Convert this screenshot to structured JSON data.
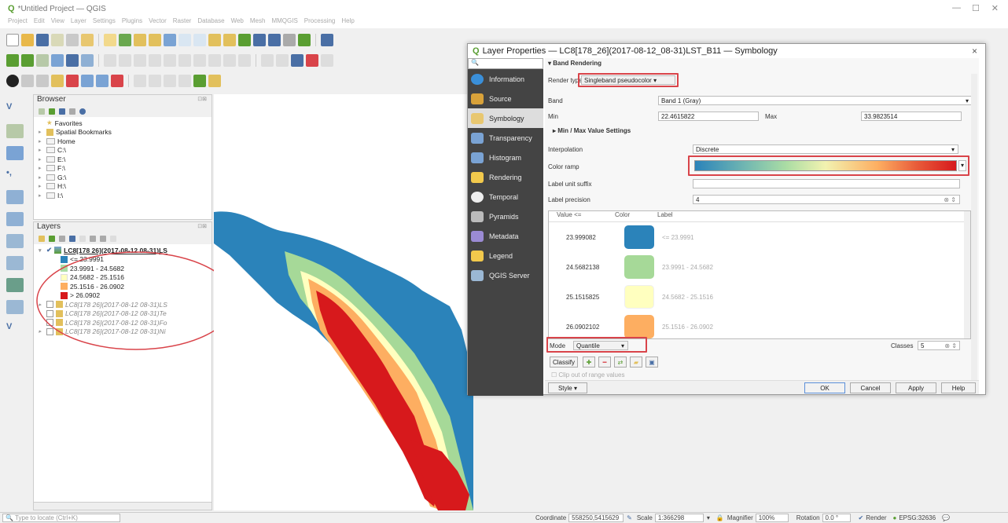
{
  "window": {
    "title": "*Untitled Project — QGIS"
  },
  "menu": [
    "Project",
    "Edit",
    "View",
    "Layer",
    "Settings",
    "Plugins",
    "Vector",
    "Raster",
    "Database",
    "Web",
    "Mesh",
    "MMQGIS",
    "Processing",
    "Help"
  ],
  "browser": {
    "title": "Browser",
    "items": [
      "Favorites",
      "Spatial Bookmarks",
      "Home",
      "C:\\",
      "E:\\",
      "F:\\",
      "G:\\",
      "H:\\",
      "I:\\"
    ]
  },
  "layers": {
    "title": "Layers",
    "active": "LC8[178 26](2017-08-12 08-31)LS",
    "legend": [
      {
        "label": "<= 23.9991",
        "color": "#2b83ba"
      },
      {
        "label": "23.9991 - 24.5682",
        "color": "#abdda4"
      },
      {
        "label": "24.5682 - 25.1516",
        "color": "#ffffbf"
      },
      {
        "label": "25.1516 - 26.0902",
        "color": "#fdae61"
      },
      {
        "label": "> 26.0902",
        "color": "#d7191c"
      }
    ],
    "others": [
      "LC8[178 26](2017-08-12 08-31)LS",
      "LC8[178 26](2017-08-12 08-31)Te",
      "LC8[178 26](2017-08-12 08-31)Fo",
      "LC8[178 26](2017-08-12 08-31)Ni"
    ]
  },
  "dialog": {
    "title": "Layer Properties — LC8[178_26](2017-08-12_08-31)LST_B11 — Symbology",
    "close": "×",
    "nav": [
      {
        "label": "Information",
        "color": "#3a8fd9"
      },
      {
        "label": "Source",
        "color": "#d9a23a"
      },
      {
        "label": "Symbology",
        "color": "#e8c770"
      },
      {
        "label": "Transparency",
        "color": "#7aa3d4"
      },
      {
        "label": "Histogram",
        "color": "#7aa3d4"
      },
      {
        "label": "Rendering",
        "color": "#f2c94c"
      },
      {
        "label": "Temporal",
        "color": "#eeeeee"
      },
      {
        "label": "Pyramids",
        "color": "#bbbbbb"
      },
      {
        "label": "Metadata",
        "color": "#9b8bd4"
      },
      {
        "label": "Legend",
        "color": "#f2c94c"
      },
      {
        "label": "QGIS Server",
        "color": "#9bb8d4"
      }
    ],
    "section": "Band Rendering",
    "render_type_label": "Render type",
    "render_type": "Singleband pseudocolor",
    "band_label": "Band",
    "band": "Band 1 (Gray)",
    "min_label": "Min",
    "min": "22.4615822",
    "max_label": "Max",
    "max": "33.9823514",
    "minmax_section": "Min / Max Value Settings",
    "interp_label": "Interpolation",
    "interp": "Discrete",
    "ramp_label": "Color ramp",
    "unit_label": "Label unit suffix",
    "precision_label": "Label precision",
    "precision": "4",
    "cols": [
      "Value <=",
      "Color",
      "Label"
    ],
    "rows": [
      {
        "value": "23.999082",
        "color": "#2b83ba",
        "label": "<= 23.9991"
      },
      {
        "value": "24.5682138",
        "color": "#a6d998",
        "label": "23.9991 - 24.5682"
      },
      {
        "value": "25.1515825",
        "color": "#ffffbf",
        "label": "24.5682 - 25.1516"
      },
      {
        "value": "26.0902102",
        "color": "#fdae61",
        "label": "25.1516 - 26.0902"
      }
    ],
    "mode_label": "Mode",
    "mode": "Quantile",
    "classes_label": "Classes",
    "classes": "5",
    "classify": "Classify",
    "clip": "Clip out of range values",
    "style": "Style",
    "ok": "OK",
    "cancel": "Cancel",
    "apply": "Apply",
    "help": "Help"
  },
  "status": {
    "locate": "Type to locate (Ctrl+K)",
    "coord_label": "Coordinate",
    "coord": "558250,5415629",
    "scale_label": "Scale",
    "scale": "1:366298",
    "mag_label": "Magnifier",
    "mag": "100%",
    "rot_label": "Rotation",
    "rot": "0.0 °",
    "render": "Render",
    "crs": "EPSG:32636"
  }
}
